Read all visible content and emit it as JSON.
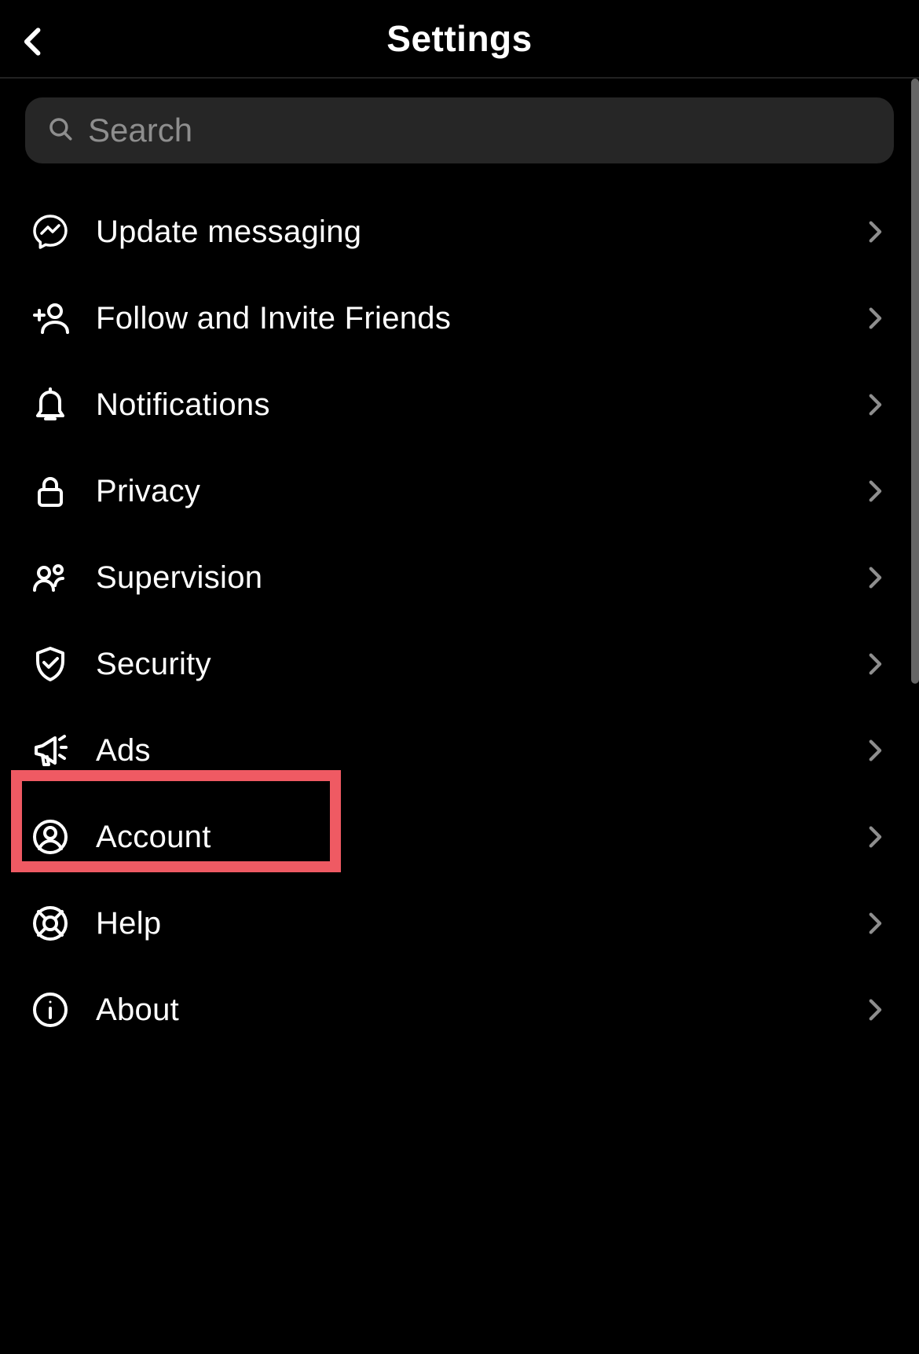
{
  "header": {
    "title": "Settings"
  },
  "search": {
    "placeholder": "Search",
    "value": ""
  },
  "menu": {
    "items": [
      {
        "id": "update-messaging",
        "icon": "messenger-icon",
        "label": "Update messaging"
      },
      {
        "id": "follow-invite",
        "icon": "add-user-icon",
        "label": "Follow and Invite Friends"
      },
      {
        "id": "notifications",
        "icon": "bell-icon",
        "label": "Notifications"
      },
      {
        "id": "privacy",
        "icon": "lock-icon",
        "label": "Privacy"
      },
      {
        "id": "supervision",
        "icon": "people-icon",
        "label": "Supervision"
      },
      {
        "id": "security",
        "icon": "shield-check-icon",
        "label": "Security"
      },
      {
        "id": "ads",
        "icon": "megaphone-icon",
        "label": "Ads"
      },
      {
        "id": "account",
        "icon": "user-circle-icon",
        "label": "Account"
      },
      {
        "id": "help",
        "icon": "lifebuoy-icon",
        "label": "Help"
      },
      {
        "id": "about",
        "icon": "info-icon",
        "label": "About"
      }
    ]
  },
  "annotation": {
    "highlighted_item_id": "account",
    "highlight_color": "#ef5a63"
  }
}
